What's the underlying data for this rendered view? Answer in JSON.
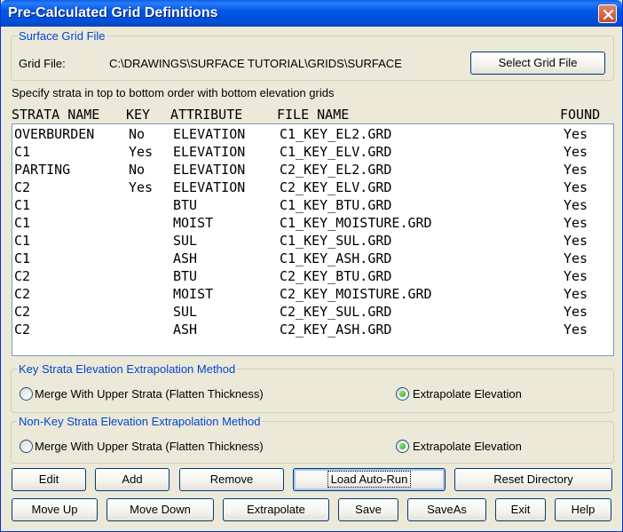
{
  "window": {
    "title": "Pre-Calculated Grid Definitions"
  },
  "surface_group": {
    "legend": "Surface Grid File",
    "grid_file_label": "Grid File:",
    "grid_file_path": "C:\\DRAWINGS\\SURFACE TUTORIAL\\GRIDS\\SURFACE",
    "select_button": "Select Grid File"
  },
  "instructions": "Specify strata in top to bottom order with bottom elevation grids",
  "table": {
    "headers": {
      "strata": "STRATA NAME",
      "key": "KEY",
      "attribute": "ATTRIBUTE",
      "file": "FILE NAME",
      "found": "FOUND"
    },
    "rows": [
      {
        "strata": "OVERBURDEN",
        "key": "No",
        "attribute": "ELEVATION",
        "file": "C1_KEY_EL2.GRD",
        "found": "Yes"
      },
      {
        "strata": "C1",
        "key": "Yes",
        "attribute": "ELEVATION",
        "file": "C1_KEY_ELV.GRD",
        "found": "Yes"
      },
      {
        "strata": "PARTING",
        "key": "No",
        "attribute": "ELEVATION",
        "file": "C2_KEY_EL2.GRD",
        "found": "Yes"
      },
      {
        "strata": "C2",
        "key": "Yes",
        "attribute": "ELEVATION",
        "file": "C2_KEY_ELV.GRD",
        "found": "Yes"
      },
      {
        "strata": "C1",
        "key": "",
        "attribute": "BTU",
        "file": "C1_KEY_BTU.GRD",
        "found": "Yes"
      },
      {
        "strata": "C1",
        "key": "",
        "attribute": "MOIST",
        "file": "C1_KEY_MOISTURE.GRD",
        "found": "Yes"
      },
      {
        "strata": "C1",
        "key": "",
        "attribute": "SUL",
        "file": "C1_KEY_SUL.GRD",
        "found": "Yes"
      },
      {
        "strata": "C1",
        "key": "",
        "attribute": "ASH",
        "file": "C1_KEY_ASH.GRD",
        "found": "Yes"
      },
      {
        "strata": "C2",
        "key": "",
        "attribute": "BTU",
        "file": "C2_KEY_BTU.GRD",
        "found": "Yes"
      },
      {
        "strata": "C2",
        "key": "",
        "attribute": "MOIST",
        "file": "C2_KEY_MOISTURE.GRD",
        "found": "Yes"
      },
      {
        "strata": "C2",
        "key": "",
        "attribute": "SUL",
        "file": "C2_KEY_SUL.GRD",
        "found": "Yes"
      },
      {
        "strata": "C2",
        "key": "",
        "attribute": "ASH",
        "file": "C2_KEY_ASH.GRD",
        "found": "Yes"
      }
    ]
  },
  "key_group": {
    "legend": "Key Strata Elevation Extrapolation Method",
    "option_merge": "Merge With Upper Strata (Flatten Thickness)",
    "option_extrapolate": "Extrapolate Elevation",
    "selected": "extrapolate"
  },
  "nonkey_group": {
    "legend": "Non-Key Strata Elevation Extrapolation Method",
    "option_merge": "Merge With Upper Strata (Flatten Thickness)",
    "option_extrapolate": "Extrapolate Elevation",
    "selected": "extrapolate"
  },
  "buttons": {
    "edit": "Edit",
    "add": "Add",
    "remove": "Remove",
    "load_auto_run": "Load Auto-Run",
    "reset_directory": "Reset Directory",
    "move_up": "Move Up",
    "move_down": "Move Down",
    "extrapolate": "Extrapolate",
    "save": "Save",
    "save_as": "SaveAs",
    "exit": "Exit",
    "help": "Help"
  }
}
